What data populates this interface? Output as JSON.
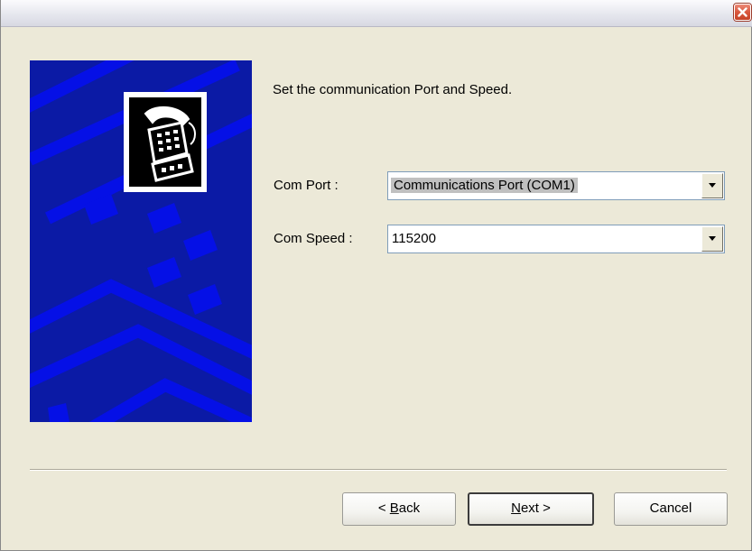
{
  "titlebar": {
    "close_icon": "close-icon",
    "close_color": "#d9573e"
  },
  "banner": {
    "background": "#0b1aa5",
    "icon": "telephone-icon"
  },
  "instruction": "Set the communication Port and Speed.",
  "com_port": {
    "label": "Com Port :",
    "value": "Communications Port (COM1)",
    "dropdown_icon": "chevron-down-icon"
  },
  "com_speed": {
    "label": "Com Speed :",
    "value": "115200",
    "dropdown_icon": "chevron-down-icon"
  },
  "buttons": {
    "back": {
      "prefix": "< ",
      "mnemonic": "B",
      "rest": "ack"
    },
    "next": {
      "mnemonic": "N",
      "rest": "ext >"
    },
    "cancel": "Cancel"
  }
}
